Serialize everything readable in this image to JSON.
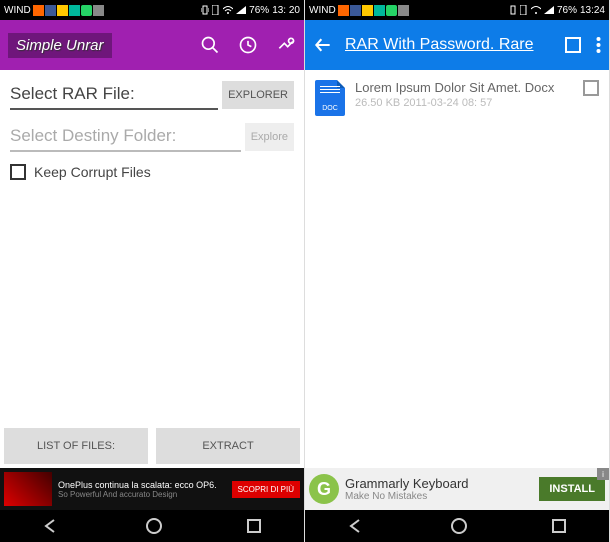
{
  "left": {
    "status": {
      "carrier": "WIND",
      "battery": "76%",
      "time": "13: 20"
    },
    "appbar": {
      "title": "Simple Unrar"
    },
    "fields": {
      "select_rar": "Select RAR File:",
      "select_dest": "Select Destiny Folder:",
      "explorer_btn": "EXPLORER",
      "explore_btn2": "Explore",
      "keep_corrupt": "Keep Corrupt Files"
    },
    "bottom": {
      "list": "LIST OF FILES:",
      "extract": "EXTRACT"
    },
    "ad": {
      "line1": "OnePlus continua la scalata: ecco OP6.",
      "line2": "So Powerful And accurato Design",
      "cta": "SCOPRI DI PIÙ"
    }
  },
  "right": {
    "status": {
      "carrier": "WIND",
      "battery": "76%",
      "time": "13:24"
    },
    "appbar": {
      "title": "RAR With Password. Rare"
    },
    "file": {
      "name": "Lorem Ipsum Dolor Sit Amet. Docx",
      "meta": "26.50 KB 2011-03-24 08: 57",
      "type": "DOC"
    },
    "ad": {
      "title": "Grammarly Keyboard",
      "sub": "Make No Mistakes",
      "cta": "INSTALL"
    }
  }
}
